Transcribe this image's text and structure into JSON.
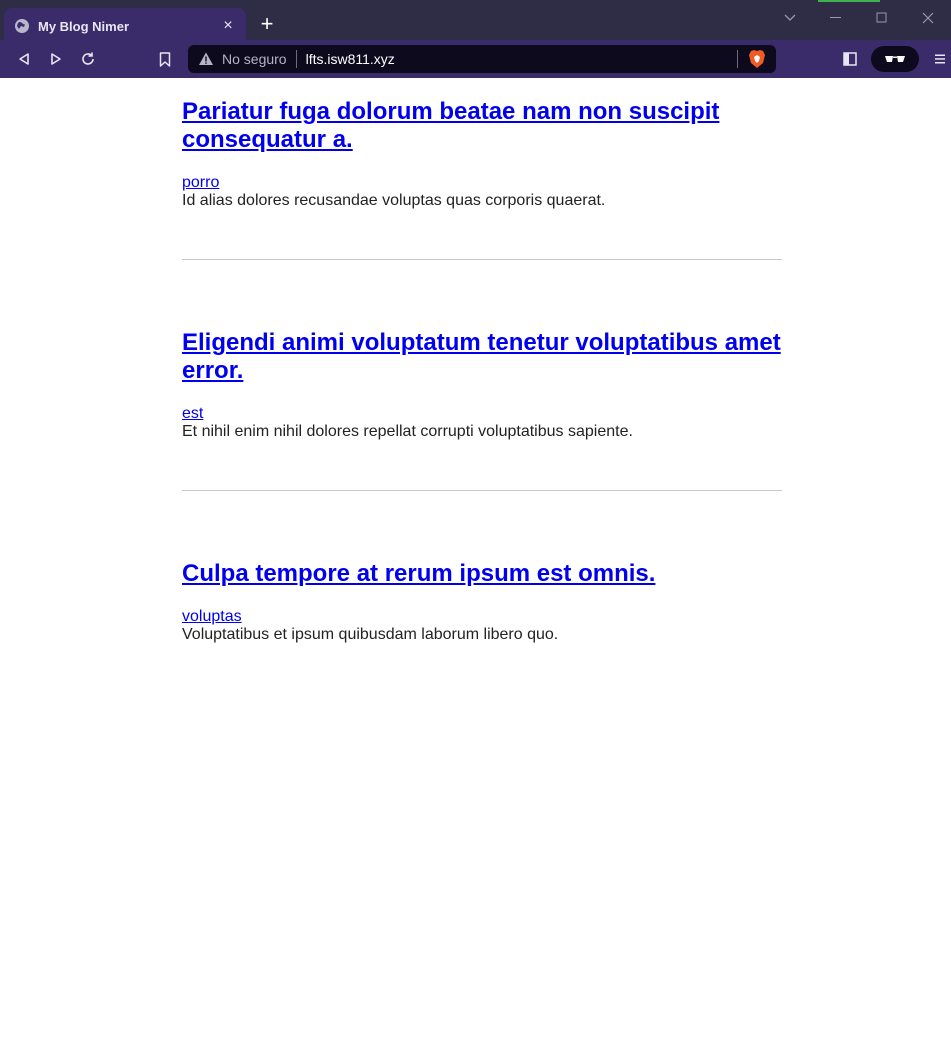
{
  "browser": {
    "tab_title": "My Blog Nimer",
    "tab_close": "×",
    "new_tab": "+",
    "not_secure_label": "No seguro",
    "url": "lfts.isw811.xyz"
  },
  "posts": [
    {
      "title": "Pariatur fuga dolorum beatae nam non suscipit consequatur a.",
      "category": "porro",
      "excerpt": "Id alias dolores recusandae voluptas quas corporis quaerat."
    },
    {
      "title": "Eligendi animi voluptatum tenetur voluptatibus amet error.",
      "category": "est",
      "excerpt": "Et nihil enim nihil dolores repellat corrupti voluptatibus sapiente."
    },
    {
      "title": "Culpa tempore at rerum ipsum est omnis.",
      "category": "voluptas",
      "excerpt": "Voluptatibus et ipsum quibusdam laborum libero quo."
    }
  ],
  "colors": {
    "link": "#0000ee",
    "chrome_tab": "#3a2c6a",
    "chrome_bg": "#2f2c45"
  }
}
